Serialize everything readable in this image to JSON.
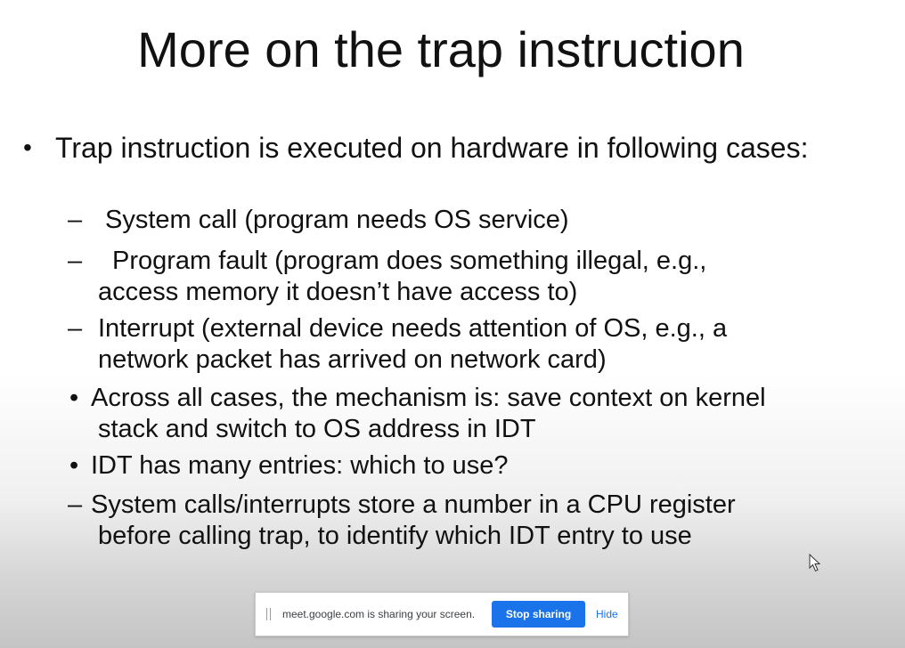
{
  "slide": {
    "title": "More on the trap instruction",
    "bullets": {
      "main": {
        "marker": "•",
        "text": "Trap instruction is executed on hardware in following cases:"
      },
      "sub1": {
        "marker": "–",
        "line1": "System call (program needs OS service)"
      },
      "sub2": {
        "marker": "–",
        "line1": "Program fault (program does something illegal, e.g.,",
        "line2": "access memory it doesn’t have access to)"
      },
      "sub3": {
        "marker": "–",
        "line1": "Interrupt (external device needs attention of OS, e.g., a",
        "line2": "network packet has arrived on network card)"
      },
      "dot1": {
        "marker": "•",
        "line1": "Across all cases, the mechanism is: save context on kernel",
        "line2": "stack and switch to OS address in IDT"
      },
      "dot2": {
        "marker": "•",
        "line1": "IDT has many entries: which to use?"
      },
      "dash4": {
        "marker": "–",
        "line1": "System calls/interrupts store a number in a CPU register",
        "line2": "before calling trap, to identify which IDT entry to use"
      }
    }
  },
  "share_bar": {
    "message": "meet.google.com is sharing your screen.",
    "stop_label": "Stop sharing",
    "hide_label": "Hide",
    "accent_color": "#1a73e8"
  },
  "icons": {
    "cursor": "mouse-pointer-icon",
    "grip": "drag-handle-icon"
  }
}
